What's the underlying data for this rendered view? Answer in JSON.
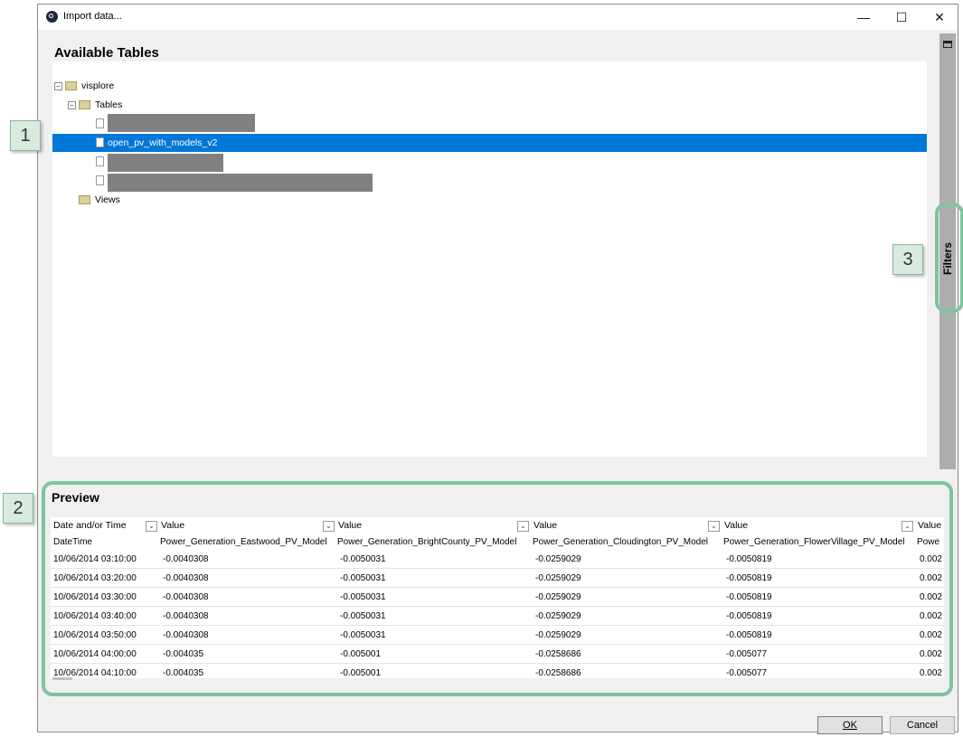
{
  "window": {
    "title": "Import data...",
    "controls": {
      "minimize": "—",
      "maximize": "☐",
      "close": "✕"
    }
  },
  "available_tables": {
    "heading": "Available Tables",
    "tree": {
      "root_label": "visplore",
      "tables_label": "Tables",
      "selected_table": "open_pv_with_models_v2",
      "views_label": "Views"
    }
  },
  "filters_tab": {
    "label": "Filters"
  },
  "callouts": [
    "1",
    "2",
    "3"
  ],
  "preview": {
    "heading": "Preview",
    "columns": [
      {
        "type": "Date and/or Time",
        "name": "DateTime"
      },
      {
        "type": "Value",
        "name": "Power_Generation_Eastwood_PV_Model"
      },
      {
        "type": "Value",
        "name": "Power_Generation_BrightCounty_PV_Model"
      },
      {
        "type": "Value",
        "name": "Power_Generation_Cloudington_PV_Model"
      },
      {
        "type": "Value",
        "name": "Power_Generation_FlowerVillage_PV_Model"
      },
      {
        "type": "Value",
        "name": "Powe"
      }
    ],
    "rows": [
      [
        "10/06/2014 03:10:00",
        "-0.0040308",
        "-0.0050031",
        "-0.0259029",
        "-0.0050819",
        "0.002"
      ],
      [
        "10/06/2014 03:20:00",
        "-0.0040308",
        "-0.0050031",
        "-0.0259029",
        "-0.0050819",
        "0.002"
      ],
      [
        "10/06/2014 03:30:00",
        "-0.0040308",
        "-0.0050031",
        "-0.0259029",
        "-0.0050819",
        "0.002"
      ],
      [
        "10/06/2014 03:40:00",
        "-0.0040308",
        "-0.0050031",
        "-0.0259029",
        "-0.0050819",
        "0.002"
      ],
      [
        "10/06/2014 03:50:00",
        "-0.0040308",
        "-0.0050031",
        "-0.0259029",
        "-0.0050819",
        "0.002"
      ],
      [
        "10/06/2014 04:00:00",
        "-0.004035",
        "-0.005001",
        "-0.0258686",
        "-0.005077",
        "0.002"
      ],
      [
        "10/06/2014 04:10:00",
        "-0.004035",
        "-0.005001",
        "-0.0258686",
        "-0.005077",
        "0.002"
      ]
    ]
  },
  "buttons": {
    "ok": "OK",
    "cancel": "Cancel"
  },
  "colors": {
    "selection": "#0078d7",
    "callout_ring": "#7dc4a0",
    "redaction": "#808080"
  }
}
